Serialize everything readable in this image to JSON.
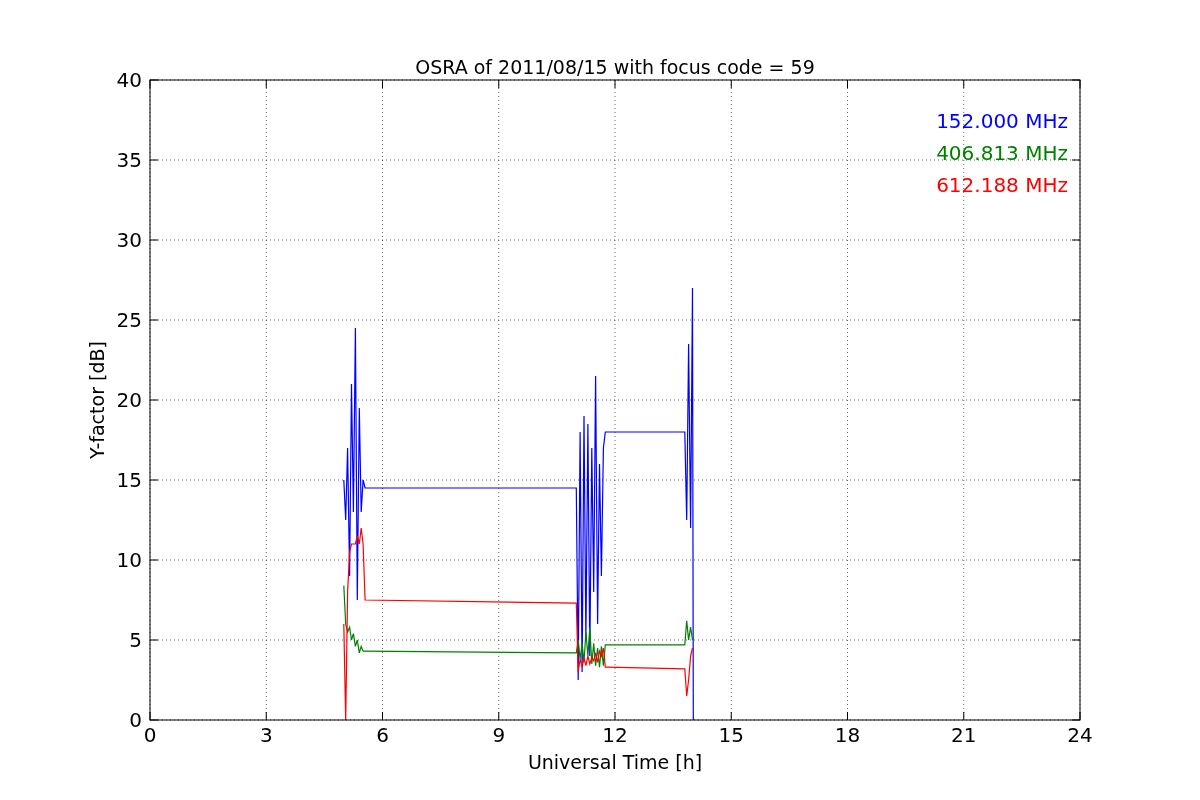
{
  "chart_data": {
    "type": "line",
    "title": "OSRA of 2011/08/15 with focus code = 59",
    "xlabel": "Universal Time [h]",
    "ylabel": "Y-factor [dB]",
    "x": [
      5.0,
      5.05,
      5.1,
      5.15,
      5.2,
      5.25,
      5.3,
      5.35,
      5.4,
      5.45,
      5.5,
      5.55,
      11.0,
      11.05,
      11.1,
      11.15,
      11.2,
      11.25,
      11.3,
      11.35,
      11.4,
      11.45,
      11.5,
      11.55,
      11.6,
      11.65,
      11.7,
      11.75,
      11.8,
      13.8,
      13.85,
      13.9,
      13.95,
      14.0,
      14.02
    ],
    "series": [
      {
        "name": "152.000 MHz",
        "color": "#0000ff",
        "values": [
          15,
          12.5,
          17,
          9,
          21,
          13,
          24.5,
          7.5,
          19.5,
          13,
          15,
          14.5,
          14.5,
          2.5,
          18,
          3,
          19,
          5,
          18.5,
          4,
          17,
          8,
          21.5,
          6,
          16,
          9,
          17,
          18,
          18,
          18,
          12.5,
          23.5,
          12,
          27,
          0
        ]
      },
      {
        "name": "406.813 MHz",
        "color": "#008000",
        "values": [
          8.4,
          6,
          5.5,
          5.8,
          5,
          5.4,
          4.6,
          5,
          4.2,
          4.6,
          4.3,
          4.3,
          4.2,
          5,
          3.8,
          4.8,
          3.6,
          5.5,
          4,
          5.8,
          3.5,
          4.8,
          3.4,
          4.5,
          3.3,
          4.6,
          3.4,
          4.7,
          4.7,
          4.7,
          6.2,
          5,
          5.8,
          5,
          null
        ]
      },
      {
        "name": "612.188 MHz",
        "color": "#ff0000",
        "values": [
          6,
          0,
          8,
          10.5,
          11,
          11,
          11,
          11.5,
          11,
          12,
          11,
          7.5,
          7.3,
          3,
          3.8,
          3.3,
          3.9,
          3.4,
          4,
          3.5,
          3.9,
          3.7,
          4.2,
          3.6,
          4.3,
          4,
          4.5,
          3.3,
          3.3,
          3.2,
          1.5,
          2.5,
          4,
          4.5,
          null
        ]
      }
    ],
    "xlim": [
      0,
      24
    ],
    "ylim": [
      0,
      40
    ],
    "xticks": [
      0,
      3,
      6,
      9,
      12,
      15,
      18,
      21,
      24
    ],
    "yticks": [
      0,
      5,
      10,
      15,
      20,
      25,
      30,
      35,
      40
    ],
    "grid": true
  }
}
